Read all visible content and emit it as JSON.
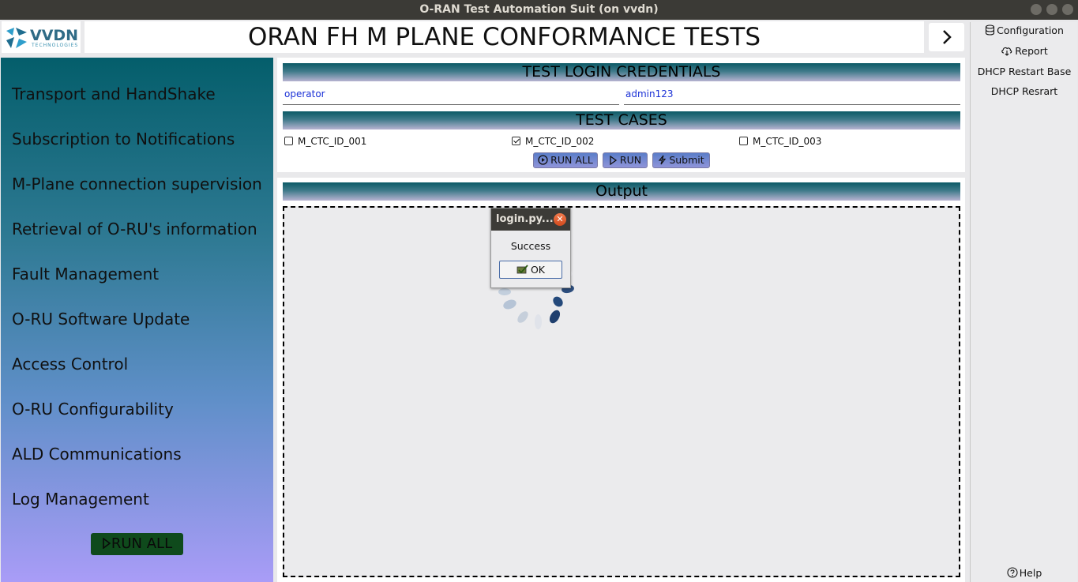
{
  "window": {
    "title": "O-RAN Test Automation Suit (on vvdn)"
  },
  "header": {
    "logo_text": "VVDN",
    "logo_subtext": "TECHNOLOGIES",
    "title": "ORAN FH M PLANE CONFORMANCE TESTS",
    "next_icon": "chevron-right-icon"
  },
  "sidebar": {
    "items": [
      {
        "label": "Transport and HandShake"
      },
      {
        "label": "Subscription to Notifications"
      },
      {
        "label": "M-Plane connection supervision"
      },
      {
        "label": "Retrieval of O-RU's information"
      },
      {
        "label": "Fault Management"
      },
      {
        "label": "O-RU Software Update"
      },
      {
        "label": "Access Control"
      },
      {
        "label": "O-RU Configurability"
      },
      {
        "label": "ALD Communications"
      },
      {
        "label": "Log Management"
      }
    ],
    "run_all_label": "RUN ALL"
  },
  "credentials": {
    "heading": "TEST LOGIN CREDENTIALS",
    "username": "operator",
    "password": "admin123"
  },
  "test_cases": {
    "heading": "TEST CASES",
    "items": [
      {
        "label": "M_CTC_ID_001",
        "checked": false
      },
      {
        "label": "M_CTC_ID_002",
        "checked": true
      },
      {
        "label": "M_CTC_ID_003",
        "checked": false
      }
    ],
    "buttons": {
      "run_all": "RUN ALL",
      "run": "RUN",
      "submit": "Submit"
    }
  },
  "output": {
    "heading": "Output"
  },
  "dialog": {
    "title": "login.py...",
    "message": "Success",
    "ok_label": "OK"
  },
  "right_panel": {
    "items": [
      {
        "label": "Configuration",
        "icon": "database-icon"
      },
      {
        "label": "Report",
        "icon": "cloud-download-icon"
      },
      {
        "label": "DHCP Restart Base"
      },
      {
        "label": "DHCP Resrart"
      }
    ],
    "help_label": "Help"
  },
  "colors": {
    "titlebar": "#3b3a36",
    "sidebar_top": "#045e6b",
    "sidebar_bottom": "#a99cf7",
    "banner": "#0c5a66",
    "credential_text": "#1b31d6",
    "run_all_side": "#0f4a1c"
  }
}
